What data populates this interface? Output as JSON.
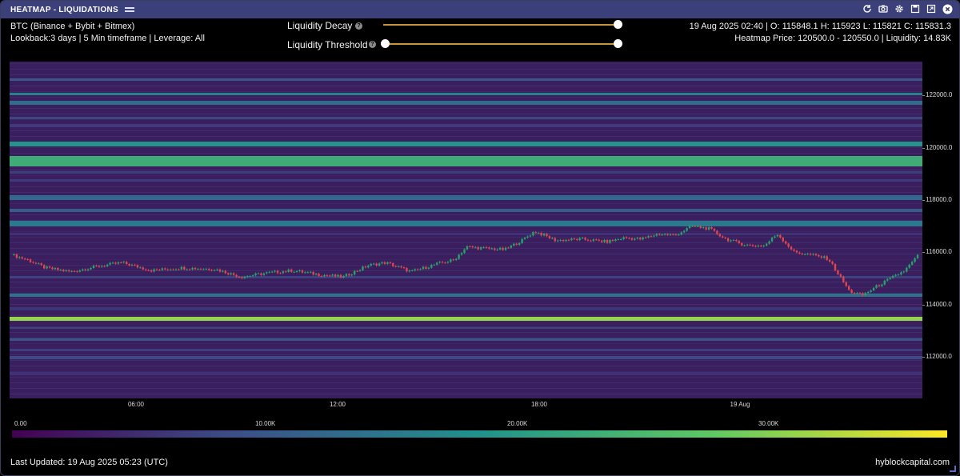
{
  "window": {
    "title": "HEATMAP - LIQUIDATIONS"
  },
  "info": {
    "symbol": "BTC (Binance + Bybit + Bitmex)",
    "lookback": "Lookback:3 days | 5 Min timeframe | Leverage: All",
    "ohlc": "19 Aug 2025 02:40 | O: 115848.1 H: 115923 L: 115821 C: 115831.3",
    "heatmap_price": "Heatmap Price: 120500.0 - 120550.0 | Liquidity: 14.83K"
  },
  "controls": {
    "decay_label": "Liquidity Decay",
    "threshold_label": "Liquidity Threshold",
    "help_glyph": "?"
  },
  "toolbar_icons": [
    "refresh-icon",
    "camera-icon",
    "gear-icon",
    "save-icon",
    "expand-icon",
    "close-icon"
  ],
  "footer": {
    "last_updated": "Last Updated: 19 Aug 2025 05:23 (UTC)",
    "brand": "hyblockcapital.com"
  },
  "chart_data": {
    "type": "heatmap",
    "title": "HEATMAP - LIQUIDATIONS",
    "y_ticks": [
      "122000.0",
      "120000.0",
      "118000.0",
      "116000.0",
      "114000.0",
      "112000.0"
    ],
    "y_tick_values": [
      122000,
      120000,
      118000,
      116000,
      114000,
      112000
    ],
    "ylim": [
      110400,
      123300
    ],
    "x_ticks": [
      "06:00",
      "12:00",
      "18:00",
      "19 Aug"
    ],
    "colorbar_ticks": [
      "0.00",
      "10.00K",
      "20.00K",
      "30.00K"
    ],
    "colorbar_values": [
      0,
      10000,
      20000,
      30000
    ],
    "colorbar_max": 37000,
    "liquidity_bands": [
      {
        "low": 113370,
        "high": 113520,
        "liquidity": 31000
      },
      {
        "low": 119300,
        "high": 119700,
        "liquidity": 23000
      },
      {
        "low": 120050,
        "high": 120250,
        "liquidity": 19000
      },
      {
        "low": 122000,
        "high": 122100,
        "liquidity": 16000
      },
      {
        "low": 117000,
        "high": 117200,
        "liquidity": 15000
      },
      {
        "low": 114280,
        "high": 114420,
        "liquidity": 14000
      },
      {
        "low": 121650,
        "high": 121800,
        "liquidity": 13000
      },
      {
        "low": 118000,
        "high": 118180,
        "liquidity": 12500
      },
      {
        "low": 117550,
        "high": 117650,
        "liquidity": 11000
      },
      {
        "low": 112600,
        "high": 112700,
        "liquidity": 9500
      },
      {
        "low": 111900,
        "high": 112020,
        "liquidity": 8500
      },
      {
        "low": 121100,
        "high": 121180,
        "liquidity": 8000
      },
      {
        "low": 122550,
        "high": 122650,
        "liquidity": 10000
      },
      {
        "low": 112200,
        "high": 112300,
        "liquidity": 7000
      },
      {
        "low": 113050,
        "high": 113140,
        "liquidity": 7500
      },
      {
        "low": 118700,
        "high": 118800,
        "liquidity": 6500
      },
      {
        "low": 115000,
        "high": 115100,
        "liquidity": 7500
      },
      {
        "low": 113800,
        "high": 113900,
        "liquidity": 6000
      },
      {
        "low": 120800,
        "high": 120900,
        "liquidity": 6500
      },
      {
        "low": 119000,
        "high": 119100,
        "liquidity": 7000
      },
      {
        "low": 111300,
        "high": 111400,
        "liquidity": 5500
      },
      {
        "low": 116650,
        "high": 116750,
        "liquidity": 5500
      }
    ],
    "price_path": [
      {
        "t": 0.0,
        "p": 115900
      },
      {
        "t": 0.02,
        "p": 115700
      },
      {
        "t": 0.04,
        "p": 115400
      },
      {
        "t": 0.07,
        "p": 115250
      },
      {
        "t": 0.1,
        "p": 115450
      },
      {
        "t": 0.13,
        "p": 115600
      },
      {
        "t": 0.165,
        "p": 115300
      },
      {
        "t": 0.2,
        "p": 115400
      },
      {
        "t": 0.24,
        "p": 115350
      },
      {
        "t": 0.27,
        "p": 115050
      },
      {
        "t": 0.3,
        "p": 115200
      },
      {
        "t": 0.33,
        "p": 115300
      },
      {
        "t": 0.36,
        "p": 115150
      },
      {
        "t": 0.39,
        "p": 115050
      },
      {
        "t": 0.42,
        "p": 115500
      },
      {
        "t": 0.44,
        "p": 115600
      },
      {
        "t": 0.47,
        "p": 115250
      },
      {
        "t": 0.5,
        "p": 115550
      },
      {
        "t": 0.52,
        "p": 115700
      },
      {
        "t": 0.535,
        "p": 116200
      },
      {
        "t": 0.555,
        "p": 116150
      },
      {
        "t": 0.58,
        "p": 116100
      },
      {
        "t": 0.6,
        "p": 116450
      },
      {
        "t": 0.615,
        "p": 116800
      },
      {
        "t": 0.64,
        "p": 116450
      },
      {
        "t": 0.67,
        "p": 116500
      },
      {
        "t": 0.7,
        "p": 116400
      },
      {
        "t": 0.72,
        "p": 116550
      },
      {
        "t": 0.74,
        "p": 116500
      },
      {
        "t": 0.76,
        "p": 116700
      },
      {
        "t": 0.78,
        "p": 116650
      },
      {
        "t": 0.8,
        "p": 117000
      },
      {
        "t": 0.82,
        "p": 116900
      },
      {
        "t": 0.84,
        "p": 116500
      },
      {
        "t": 0.86,
        "p": 116300
      },
      {
        "t": 0.87,
        "p": 116250
      },
      {
        "t": 0.885,
        "p": 116250
      },
      {
        "t": 0.9,
        "p": 116700
      },
      {
        "t": 0.92,
        "p": 116000
      },
      {
        "t": 0.94,
        "p": 115900
      },
      {
        "t": 0.96,
        "p": 115750
      },
      {
        "t": 0.985,
        "p": 114500
      },
      {
        "t": 1.0,
        "p": 114350
      },
      {
        "t": 1.02,
        "p": 114750
      },
      {
        "t": 1.05,
        "p": 115300
      },
      {
        "t": 1.065,
        "p": 115850
      }
    ]
  }
}
